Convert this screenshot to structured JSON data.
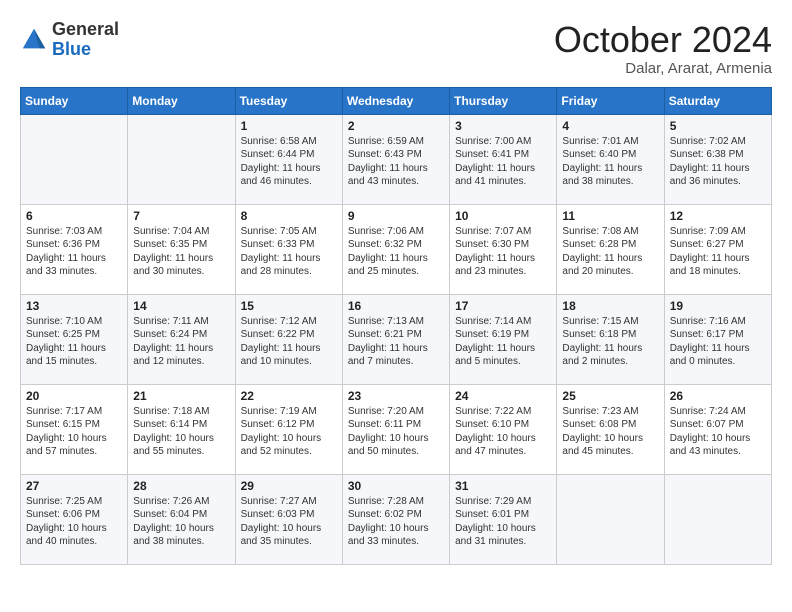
{
  "header": {
    "logo_general": "General",
    "logo_blue": "Blue",
    "month": "October 2024",
    "location": "Dalar, Ararat, Armenia"
  },
  "weekdays": [
    "Sunday",
    "Monday",
    "Tuesday",
    "Wednesday",
    "Thursday",
    "Friday",
    "Saturday"
  ],
  "weeks": [
    [
      {
        "day": "",
        "info": ""
      },
      {
        "day": "",
        "info": ""
      },
      {
        "day": "1",
        "info": "Sunrise: 6:58 AM\nSunset: 6:44 PM\nDaylight: 11 hours and 46 minutes."
      },
      {
        "day": "2",
        "info": "Sunrise: 6:59 AM\nSunset: 6:43 PM\nDaylight: 11 hours and 43 minutes."
      },
      {
        "day": "3",
        "info": "Sunrise: 7:00 AM\nSunset: 6:41 PM\nDaylight: 11 hours and 41 minutes."
      },
      {
        "day": "4",
        "info": "Sunrise: 7:01 AM\nSunset: 6:40 PM\nDaylight: 11 hours and 38 minutes."
      },
      {
        "day": "5",
        "info": "Sunrise: 7:02 AM\nSunset: 6:38 PM\nDaylight: 11 hours and 36 minutes."
      }
    ],
    [
      {
        "day": "6",
        "info": "Sunrise: 7:03 AM\nSunset: 6:36 PM\nDaylight: 11 hours and 33 minutes."
      },
      {
        "day": "7",
        "info": "Sunrise: 7:04 AM\nSunset: 6:35 PM\nDaylight: 11 hours and 30 minutes."
      },
      {
        "day": "8",
        "info": "Sunrise: 7:05 AM\nSunset: 6:33 PM\nDaylight: 11 hours and 28 minutes."
      },
      {
        "day": "9",
        "info": "Sunrise: 7:06 AM\nSunset: 6:32 PM\nDaylight: 11 hours and 25 minutes."
      },
      {
        "day": "10",
        "info": "Sunrise: 7:07 AM\nSunset: 6:30 PM\nDaylight: 11 hours and 23 minutes."
      },
      {
        "day": "11",
        "info": "Sunrise: 7:08 AM\nSunset: 6:28 PM\nDaylight: 11 hours and 20 minutes."
      },
      {
        "day": "12",
        "info": "Sunrise: 7:09 AM\nSunset: 6:27 PM\nDaylight: 11 hours and 18 minutes."
      }
    ],
    [
      {
        "day": "13",
        "info": "Sunrise: 7:10 AM\nSunset: 6:25 PM\nDaylight: 11 hours and 15 minutes."
      },
      {
        "day": "14",
        "info": "Sunrise: 7:11 AM\nSunset: 6:24 PM\nDaylight: 11 hours and 12 minutes."
      },
      {
        "day": "15",
        "info": "Sunrise: 7:12 AM\nSunset: 6:22 PM\nDaylight: 11 hours and 10 minutes."
      },
      {
        "day": "16",
        "info": "Sunrise: 7:13 AM\nSunset: 6:21 PM\nDaylight: 11 hours and 7 minutes."
      },
      {
        "day": "17",
        "info": "Sunrise: 7:14 AM\nSunset: 6:19 PM\nDaylight: 11 hours and 5 minutes."
      },
      {
        "day": "18",
        "info": "Sunrise: 7:15 AM\nSunset: 6:18 PM\nDaylight: 11 hours and 2 minutes."
      },
      {
        "day": "19",
        "info": "Sunrise: 7:16 AM\nSunset: 6:17 PM\nDaylight: 11 hours and 0 minutes."
      }
    ],
    [
      {
        "day": "20",
        "info": "Sunrise: 7:17 AM\nSunset: 6:15 PM\nDaylight: 10 hours and 57 minutes."
      },
      {
        "day": "21",
        "info": "Sunrise: 7:18 AM\nSunset: 6:14 PM\nDaylight: 10 hours and 55 minutes."
      },
      {
        "day": "22",
        "info": "Sunrise: 7:19 AM\nSunset: 6:12 PM\nDaylight: 10 hours and 52 minutes."
      },
      {
        "day": "23",
        "info": "Sunrise: 7:20 AM\nSunset: 6:11 PM\nDaylight: 10 hours and 50 minutes."
      },
      {
        "day": "24",
        "info": "Sunrise: 7:22 AM\nSunset: 6:10 PM\nDaylight: 10 hours and 47 minutes."
      },
      {
        "day": "25",
        "info": "Sunrise: 7:23 AM\nSunset: 6:08 PM\nDaylight: 10 hours and 45 minutes."
      },
      {
        "day": "26",
        "info": "Sunrise: 7:24 AM\nSunset: 6:07 PM\nDaylight: 10 hours and 43 minutes."
      }
    ],
    [
      {
        "day": "27",
        "info": "Sunrise: 7:25 AM\nSunset: 6:06 PM\nDaylight: 10 hours and 40 minutes."
      },
      {
        "day": "28",
        "info": "Sunrise: 7:26 AM\nSunset: 6:04 PM\nDaylight: 10 hours and 38 minutes."
      },
      {
        "day": "29",
        "info": "Sunrise: 7:27 AM\nSunset: 6:03 PM\nDaylight: 10 hours and 35 minutes."
      },
      {
        "day": "30",
        "info": "Sunrise: 7:28 AM\nSunset: 6:02 PM\nDaylight: 10 hours and 33 minutes."
      },
      {
        "day": "31",
        "info": "Sunrise: 7:29 AM\nSunset: 6:01 PM\nDaylight: 10 hours and 31 minutes."
      },
      {
        "day": "",
        "info": ""
      },
      {
        "day": "",
        "info": ""
      }
    ]
  ]
}
